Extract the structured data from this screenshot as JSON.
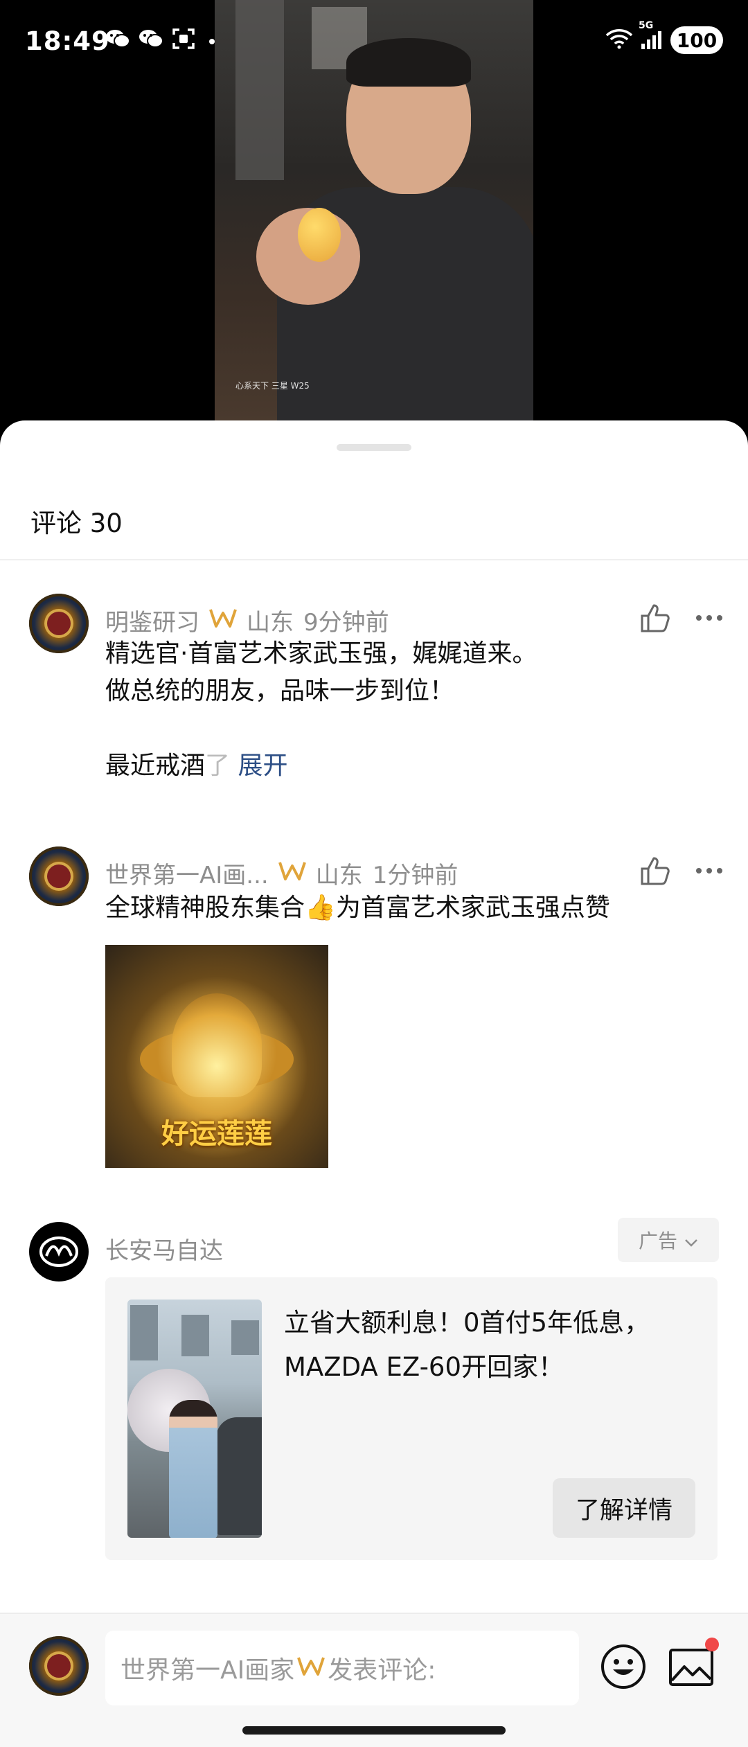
{
  "status_bar": {
    "time": "18:49",
    "left_icons": [
      "wechat-icon",
      "wechat-icon",
      "screenshot-icon"
    ],
    "network": "5G",
    "wifi_label": "5",
    "battery": "100"
  },
  "video": {
    "caption": "心系天下 三星 W25"
  },
  "sheet": {
    "title": "评论 30"
  },
  "comments": [
    {
      "user": "明鉴研习",
      "badge_icon": "vip-w-icon",
      "location": "山东",
      "time": "9分钟前",
      "text": "精选官·首富艺术家武玉强，娓娓道来。\n做总统的朋友，品味一步到位！\n\n最近戒酒",
      "text_fade": "了",
      "expand_label": "展开"
    },
    {
      "user": "世界第一AI画...",
      "badge_icon": "vip-w-icon",
      "location": "山东",
      "time": "1分钟前",
      "text_before": "全球精神股东集合",
      "emoji": "👍",
      "text_after": "为首富艺术家武玉强点赞",
      "image_text": "好运莲莲"
    }
  ],
  "ad": {
    "advertiser": "长安马自达",
    "tag": "广告",
    "copy": "立省大额利息！0首付5年低息，MAZDA EZ-60开回家！",
    "button": "了解详情"
  },
  "input_bar": {
    "placeholder_prefix": "世界第一AI画家",
    "placeholder_suffix": "发表评论:"
  },
  "colors": {
    "accent_blue": "#2d4f86",
    "vip_gold": "#e0a43a",
    "notification_red": "#f04848"
  }
}
